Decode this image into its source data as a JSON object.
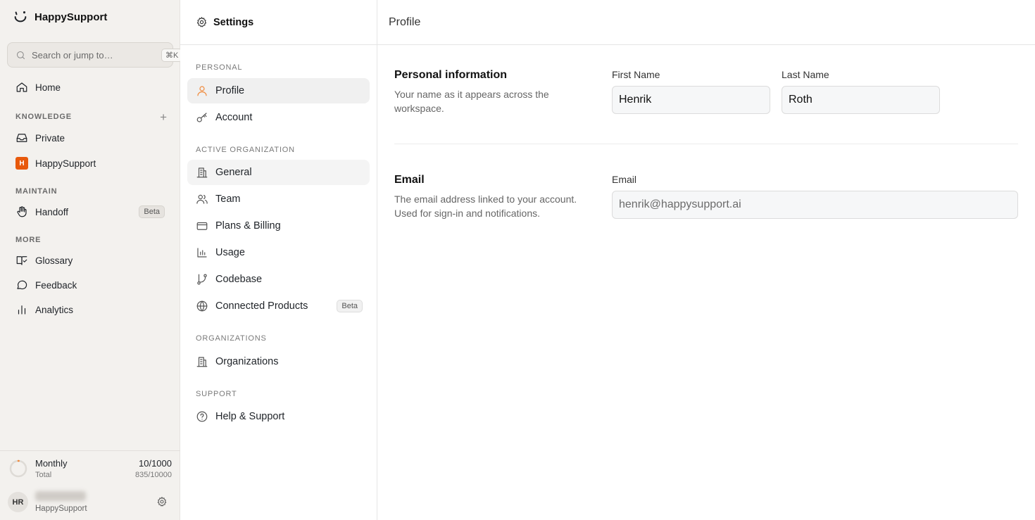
{
  "app": {
    "name": "HappySupport",
    "search_placeholder": "Search or jump to…",
    "search_shortcut": "⌘K"
  },
  "sidebar": {
    "home": "Home",
    "knowledge_label": "KNOWLEDGE",
    "knowledge_add": "+",
    "private": "Private",
    "org": {
      "label": "HappySupport",
      "initial": "H",
      "color": "#e8590c"
    },
    "maintain_label": "MAINTAIN",
    "handoff": "Handoff",
    "handoff_badge": "Beta",
    "more_label": "MORE",
    "glossary": "Glossary",
    "feedback": "Feedback",
    "analytics": "Analytics"
  },
  "usage": {
    "title": "Monthly",
    "count": "10/1000",
    "sub": "Total",
    "total": "835/10000",
    "fraction": 0.01
  },
  "user": {
    "initials": "HR",
    "org": "HappySupport"
  },
  "settings": {
    "title": "Settings",
    "personal_label": "PERSONAL",
    "profile": "Profile",
    "account": "Account",
    "active_org_label": "ACTIVE ORGANIZATION",
    "general": "General",
    "team": "Team",
    "plans": "Plans & Billing",
    "usage": "Usage",
    "codebase": "Codebase",
    "connected": "Connected Products",
    "connected_badge": "Beta",
    "orgs_label": "ORGANIZATIONS",
    "organizations": "Organizations",
    "support_label": "SUPPORT",
    "help": "Help & Support"
  },
  "main": {
    "header": "Profile",
    "personal": {
      "title": "Personal information",
      "desc": "Your name as it appears across the workspace.",
      "first_label": "First Name",
      "first_value": "Henrik",
      "last_label": "Last Name",
      "last_value": "Roth"
    },
    "email": {
      "title": "Email",
      "desc": "The email address linked to your account. Used for sign-in and notifications.",
      "label": "Email",
      "value": "henrik@happysupport.ai"
    }
  },
  "colors": {
    "accent": "#f08a3c",
    "org_badge": "#e8590c"
  }
}
